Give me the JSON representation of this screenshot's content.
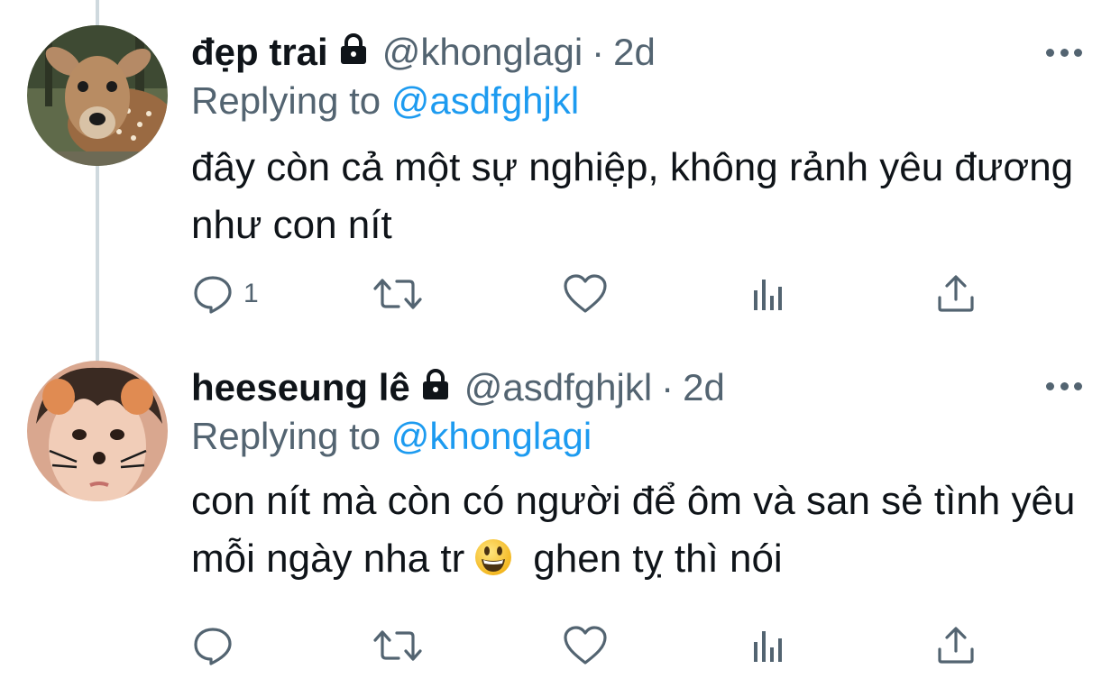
{
  "tweets": [
    {
      "name": "đẹp trai",
      "handle": "@khonglagi",
      "separator": "·",
      "time": "2d",
      "replying_prefix": "Replying to",
      "replying_to": "@asdfghjkl",
      "text": "đây còn cả một sự nghiệp, không rảnh yêu đương như con nít",
      "reply_count": "1",
      "avatar_icon": "deer-avatar-icon"
    },
    {
      "name": "heeseung lê",
      "handle": "@asdfghjkl",
      "separator": "·",
      "time": "2d",
      "replying_prefix": "Replying to",
      "replying_to": "@khonglagi",
      "text_before_emoji": "con nít mà còn có người để ôm và san sẻ tình yêu mỗi ngày nha tr",
      "text_after_emoji": "ghen tỵ thì nói",
      "emoji": "grinning-face-emoji",
      "reply_count": "",
      "avatar_icon": "cat-face-person-avatar-icon"
    }
  ],
  "colors": {
    "accent": "#1d9bf0",
    "text": "#0f1419",
    "muted": "#536471",
    "thread_line": "#cfd9de"
  }
}
